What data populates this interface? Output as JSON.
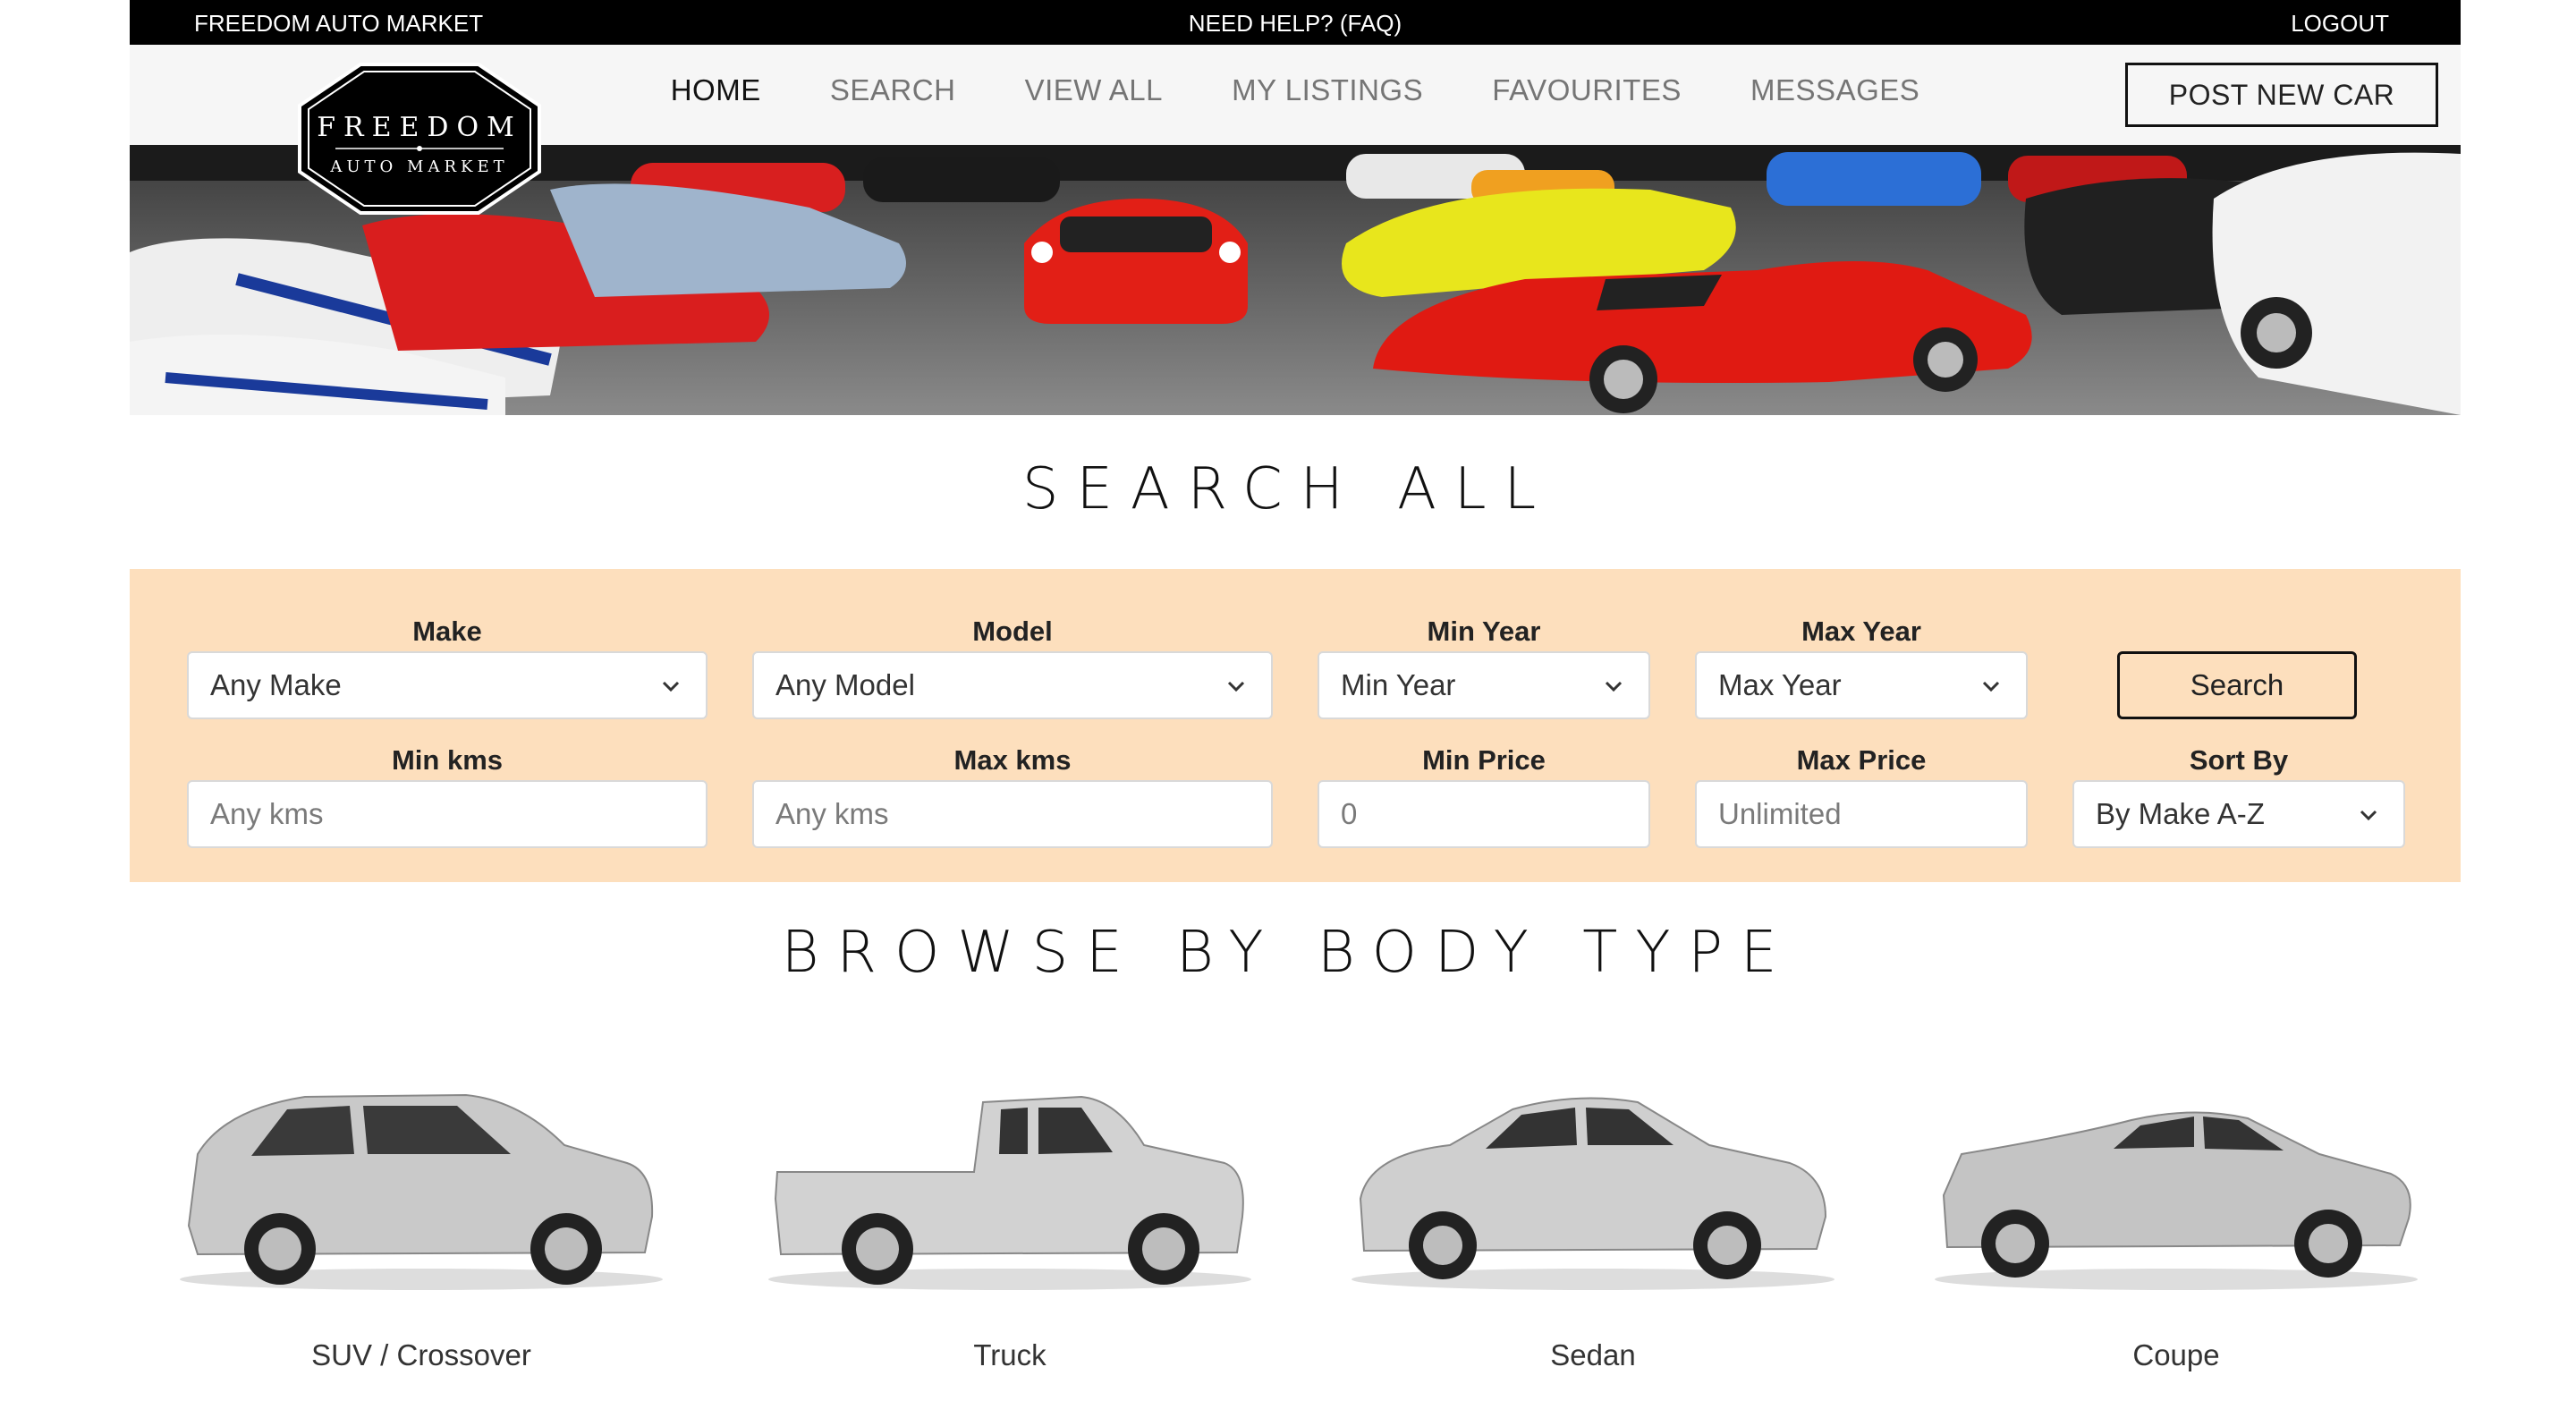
{
  "topbar": {
    "brand": "FREEDOM AUTO MARKET",
    "help": "NEED HELP? (FAQ)",
    "logout": "LOGOUT"
  },
  "logo": {
    "line1": "FREEDOM",
    "line2": "AUTO MARKET"
  },
  "nav": {
    "items": [
      {
        "label": "HOME",
        "active": true
      },
      {
        "label": "SEARCH"
      },
      {
        "label": "VIEW ALL"
      },
      {
        "label": "MY LISTINGS"
      },
      {
        "label": "FAVOURITES"
      },
      {
        "label": "MESSAGES"
      }
    ],
    "post_button": "POST NEW CAR"
  },
  "hero": {
    "image": "showroom-of-sports-cars"
  },
  "search": {
    "title": "SEARCH ALL",
    "make": {
      "label": "Make",
      "value": "Any Make"
    },
    "model": {
      "label": "Model",
      "value": "Any Model"
    },
    "min_year": {
      "label": "Min Year",
      "value": "Min Year"
    },
    "max_year": {
      "label": "Max Year",
      "value": "Max Year"
    },
    "button": "Search",
    "min_kms": {
      "label": "Min kms",
      "placeholder": "Any kms"
    },
    "max_kms": {
      "label": "Max kms",
      "placeholder": "Any kms"
    },
    "min_price": {
      "label": "Min Price",
      "placeholder": "0"
    },
    "max_price": {
      "label": "Max Price",
      "placeholder": "Unlimited"
    },
    "sort": {
      "label": "Sort By",
      "value": "By Make A-Z"
    },
    "panel_color": "#fddfbd"
  },
  "browse": {
    "title": "BROWSE BY BODY TYPE",
    "types": [
      {
        "label": "SUV / Crossover"
      },
      {
        "label": "Truck"
      },
      {
        "label": "Sedan"
      },
      {
        "label": "Coupe"
      }
    ]
  }
}
